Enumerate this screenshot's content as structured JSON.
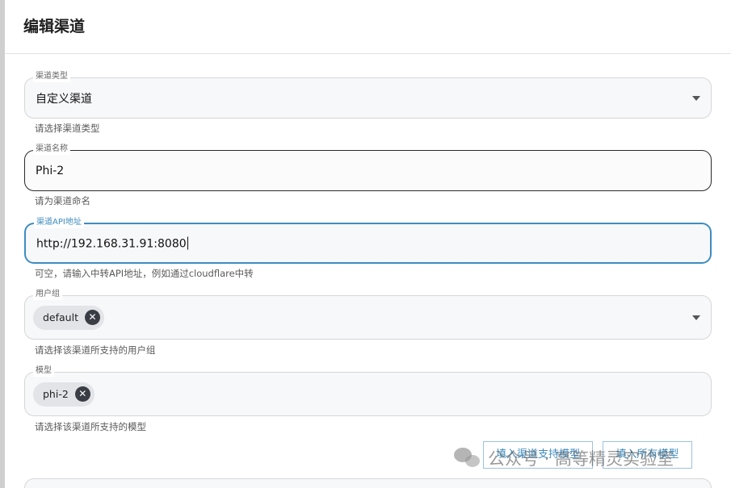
{
  "dialog": {
    "title": "编辑渠道"
  },
  "fields": {
    "channel_type": {
      "label": "渠道类型",
      "value": "自定义渠道",
      "helper": "请选择渠道类型"
    },
    "channel_name": {
      "label": "渠道名称",
      "value": "Phi-2",
      "helper": "请为渠道命名"
    },
    "channel_api": {
      "label": "渠道API地址",
      "value": "http://192.168.31.91:8080",
      "helper": "可空，请输入中转API地址，例如通过cloudflare中转"
    },
    "user_group": {
      "label": "用户组",
      "chips": [
        "default"
      ],
      "helper": "请选择该渠道所支持的用户组"
    },
    "models": {
      "label": "模型",
      "chips": [
        "phi-2"
      ],
      "helper": "请选择该渠道所支持的模型"
    }
  },
  "buttons": {
    "fill_supported": "填入渠道支持模型",
    "fill_all": "填入所有模型"
  },
  "watermark": {
    "text": "公众号 · 高等精灵实验室"
  },
  "icons": {
    "chip_remove": "close-circle-icon",
    "dropdown": "caret-down-icon",
    "watermark_logo": "wechat-icon"
  },
  "colors": {
    "accent": "#3e8cc0",
    "chip_bg": "#e2e4e8",
    "field_bg": "#f7f8fa"
  }
}
